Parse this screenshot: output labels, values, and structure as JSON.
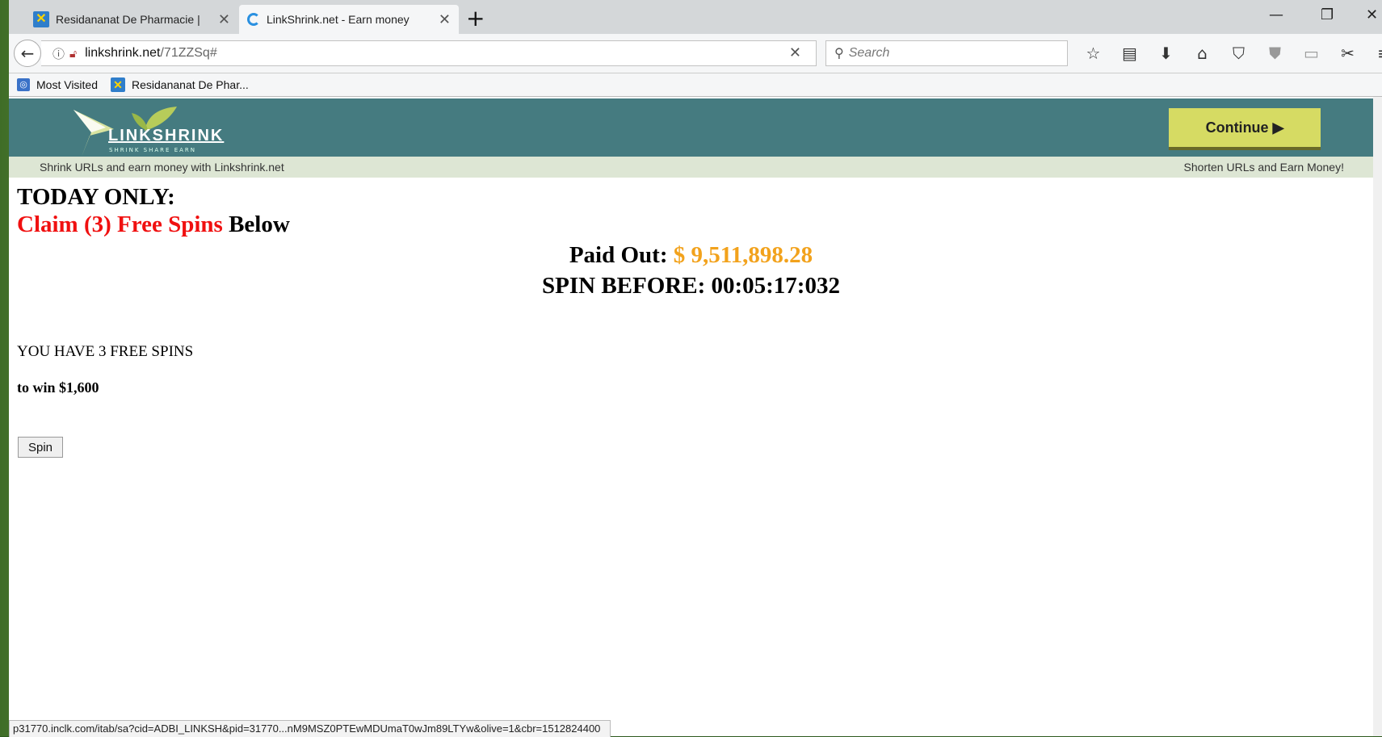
{
  "tabs": [
    {
      "title": "Residananat De Pharmacie |",
      "active": false
    },
    {
      "title": "LinkShrink.net - Earn money",
      "active": true
    }
  ],
  "nav": {
    "url_host": "linkshrink.net",
    "url_path": "/71ZZSq#",
    "search_placeholder": "Search"
  },
  "bookmarks": [
    {
      "label": "Most Visited",
      "icon": "most-visited-icon"
    },
    {
      "label": "Residananat De Phar...",
      "icon": "pharmacie-favicon"
    }
  ],
  "site": {
    "logo_text": "LINKSHRINK",
    "logo_tagline": "SHRINK SHARE EARN",
    "continue_label": "Continue ▶",
    "tagline_left": "Shrink URLs and earn money with Linkshrink.net",
    "tagline_right": "Shorten URLs and Earn Money!"
  },
  "promo": {
    "today_only": "TODAY ONLY:",
    "claim_red": "Claim (3) Free Spins",
    "claim_rest": " Below",
    "paid_label": "Paid Out: ",
    "paid_amount": "$ 9,511,898.28",
    "spin_before": "SPIN BEFORE: 00:05:17:032",
    "free_spins": "YOU HAVE 3 FREE SPINS",
    "to_win": "to win $1,600",
    "spin_button": "Spin"
  },
  "status_url": "p31770.inclk.com/itab/sa?cid=ADBI_LINKSH&pid=31770...nM9MSZ0PTEwMDUmaT0wJm89LTYw&olive=1&cbr=1512824400",
  "colors": {
    "header_bg": "#457b80",
    "continue_bg": "#d6db63",
    "claim_red": "#f01010",
    "paid_amount": "#f2a21c"
  }
}
